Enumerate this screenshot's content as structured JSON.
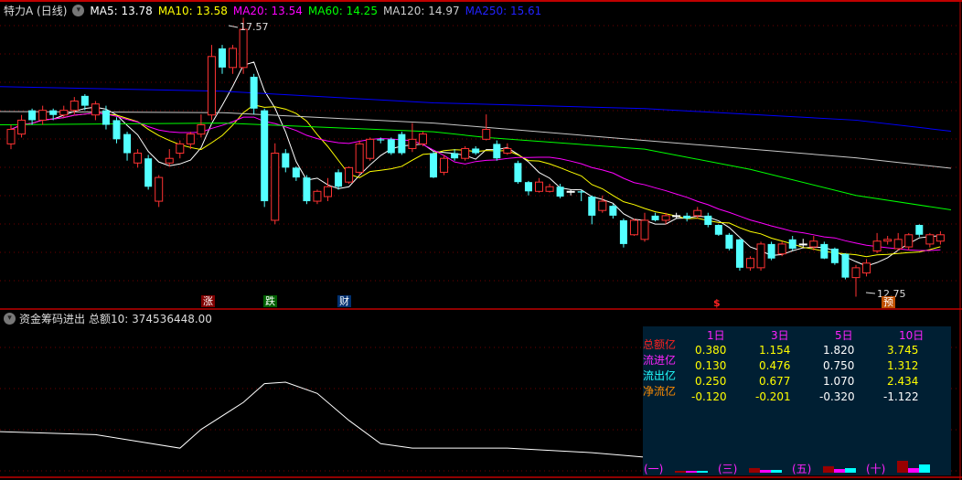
{
  "header": {
    "title": "特力A (日线)",
    "ma5": "MA5: 13.78",
    "ma10": "MA10: 13.58",
    "ma20": "MA20: 13.54",
    "ma60": "MA60: 14.25",
    "ma120": "MA120: 14.97",
    "ma250": "MA250: 15.61"
  },
  "annotations": {
    "high": "17.57",
    "low": "12.75",
    "tag_up": "涨",
    "tag_down": "跌",
    "tag_fin": "财",
    "tag_s": "$",
    "tag_pre": "预"
  },
  "indicator": {
    "title": "资金筹码进出",
    "total": "总额10: 374536448.00"
  },
  "table": {
    "columns": [
      "1日",
      "3日",
      "5日",
      "10日"
    ],
    "rows": [
      {
        "label": "总额亿",
        "color": "#ff2020",
        "values": [
          "0.380",
          "1.154",
          "1.820",
          "3.745"
        ]
      },
      {
        "label": "流进亿",
        "color": "#ff22ff",
        "values": [
          "0.130",
          "0.476",
          "0.750",
          "1.312"
        ]
      },
      {
        "label": "流出亿",
        "color": "#22ffff",
        "values": [
          "0.250",
          "0.677",
          "1.070",
          "2.434"
        ]
      },
      {
        "label": "净流亿",
        "color": "#ff8c00",
        "values": [
          "-0.120",
          "-0.201",
          "-0.320",
          "-1.122"
        ]
      }
    ],
    "bar_groups": [
      {
        "label": "(一)",
        "values": [
          0.13,
          0.13,
          0.13
        ]
      },
      {
        "label": "(三)",
        "values": [
          0.38,
          0.21,
          0.21
        ]
      },
      {
        "label": "(五)",
        "values": [
          0.55,
          0.33,
          0.38
        ]
      },
      {
        "label": "(十)",
        "values": [
          1.0,
          0.38,
          0.7
        ]
      }
    ]
  },
  "colors": {
    "up": "#ff3232",
    "down": "#54ffff",
    "ma5": "#ffffff",
    "ma10": "#ffff00",
    "ma20": "#ff00ff",
    "ma60": "#00ff00",
    "ma120": "#c8c8c8",
    "ma250": "#0000ff",
    "bg": "#000000"
  },
  "chart_data": {
    "type": "candlestick",
    "ylim": [
      12.6,
      17.75
    ],
    "candles_ocHL": [
      [
        15.39,
        15.64,
        15.72,
        15.3
      ],
      [
        15.56,
        15.8,
        15.89,
        15.5
      ],
      [
        15.97,
        15.8,
        16.0,
        15.72
      ],
      [
        15.8,
        15.97,
        16.05,
        15.72
      ],
      [
        15.97,
        15.89,
        16.0,
        15.8
      ],
      [
        15.89,
        15.97,
        16.05,
        15.85
      ],
      [
        15.97,
        16.13,
        16.2,
        15.9
      ],
      [
        16.22,
        16.05,
        16.25,
        15.97
      ],
      [
        15.89,
        16.08,
        16.13,
        15.8
      ],
      [
        15.97,
        15.72,
        16.05,
        15.64
      ],
      [
        15.8,
        15.47,
        15.85,
        15.4
      ],
      [
        15.56,
        15.23,
        15.6,
        15.1
      ],
      [
        15.06,
        15.23,
        15.3,
        14.98
      ],
      [
        15.14,
        14.65,
        15.2,
        14.6
      ],
      [
        14.4,
        14.81,
        14.85,
        14.3
      ],
      [
        15.06,
        15.14,
        15.3,
        15.0
      ],
      [
        15.23,
        15.39,
        15.45,
        15.14
      ],
      [
        15.39,
        15.56,
        15.6,
        15.3
      ],
      [
        15.56,
        15.72,
        15.9,
        15.5
      ],
      [
        15.89,
        16.9,
        17.1,
        15.8
      ],
      [
        17.04,
        16.71,
        17.1,
        16.6
      ],
      [
        16.71,
        17.04,
        17.1,
        16.6
      ],
      [
        16.71,
        17.37,
        17.57,
        16.6
      ],
      [
        16.55,
        16.0,
        16.6,
        15.9
      ],
      [
        15.97,
        14.4,
        16.0,
        14.3
      ],
      [
        14.07,
        15.23,
        15.4,
        14.0
      ],
      [
        15.23,
        14.98,
        15.3,
        14.9
      ],
      [
        14.98,
        14.81,
        15.0,
        14.75
      ],
      [
        14.81,
        14.4,
        14.85,
        14.35
      ],
      [
        14.4,
        14.57,
        14.6,
        14.35
      ],
      [
        14.48,
        14.65,
        14.8,
        14.4
      ],
      [
        14.9,
        14.65,
        14.95,
        14.6
      ],
      [
        14.73,
        14.98,
        15.0,
        14.7
      ],
      [
        14.9,
        15.39,
        15.45,
        14.85
      ],
      [
        15.14,
        15.47,
        15.5,
        15.1
      ],
      [
        15.47,
        15.45,
        15.5,
        15.4
      ],
      [
        15.47,
        15.23,
        15.5,
        15.2
      ],
      [
        15.56,
        15.23,
        15.6,
        15.2
      ],
      [
        15.31,
        15.47,
        15.75,
        15.25
      ],
      [
        15.39,
        15.56,
        15.6,
        15.35
      ],
      [
        15.23,
        14.81,
        15.25,
        14.8
      ],
      [
        14.9,
        15.14,
        15.2,
        14.85
      ],
      [
        15.23,
        15.14,
        15.3,
        15.1
      ],
      [
        15.14,
        15.31,
        15.35,
        15.1
      ],
      [
        15.31,
        15.23,
        15.35,
        15.2
      ],
      [
        15.47,
        15.64,
        15.9,
        15.45
      ],
      [
        15.39,
        15.14,
        15.45,
        15.1
      ],
      [
        15.23,
        15.31,
        15.4,
        15.2
      ],
      [
        15.06,
        14.73,
        15.1,
        14.7
      ],
      [
        14.73,
        14.57,
        14.75,
        14.5
      ],
      [
        14.57,
        14.73,
        14.8,
        14.55
      ],
      [
        14.57,
        14.65,
        14.7,
        14.55
      ],
      [
        14.65,
        14.48,
        14.7,
        14.45
      ],
      [
        14.57,
        14.57,
        14.6,
        14.5
      ],
      [
        14.57,
        14.55,
        14.6,
        14.4
      ],
      [
        14.48,
        14.15,
        14.5,
        14.0
      ],
      [
        14.24,
        14.4,
        14.5,
        14.2
      ],
      [
        14.32,
        14.15,
        14.35,
        14.1
      ],
      [
        14.07,
        13.66,
        14.1,
        13.6
      ],
      [
        13.82,
        14.07,
        14.1,
        13.8
      ],
      [
        13.74,
        14.07,
        14.2,
        13.7
      ],
      [
        14.15,
        14.07,
        14.2,
        14.05
      ],
      [
        14.07,
        14.15,
        14.2,
        14.0
      ],
      [
        14.15,
        14.15,
        14.2,
        14.1
      ],
      [
        14.15,
        14.1,
        14.2,
        14.05
      ],
      [
        14.15,
        14.24,
        14.3,
        14.1
      ],
      [
        14.15,
        13.99,
        14.2,
        13.95
      ],
      [
        13.99,
        13.82,
        14.0,
        13.8
      ],
      [
        13.82,
        13.58,
        13.85,
        13.55
      ],
      [
        13.74,
        13.25,
        13.75,
        13.2
      ],
      [
        13.25,
        13.41,
        13.45,
        13.2
      ],
      [
        13.25,
        13.66,
        13.7,
        13.2
      ],
      [
        13.66,
        13.41,
        13.7,
        13.38
      ],
      [
        13.49,
        13.66,
        13.7,
        13.45
      ],
      [
        13.74,
        13.58,
        13.8,
        13.55
      ],
      [
        13.66,
        13.66,
        13.75,
        13.6
      ],
      [
        13.61,
        13.71,
        13.8,
        13.55
      ],
      [
        13.66,
        13.41,
        13.7,
        13.4
      ],
      [
        13.58,
        13.33,
        13.6,
        13.3
      ],
      [
        13.49,
        13.08,
        13.5,
        13.05
      ],
      [
        13.08,
        13.25,
        13.3,
        12.75
      ],
      [
        13.16,
        13.33,
        13.4,
        13.1
      ],
      [
        13.54,
        13.71,
        13.85,
        13.5
      ],
      [
        13.71,
        13.74,
        13.8,
        13.65
      ],
      [
        13.58,
        13.74,
        13.85,
        13.55
      ],
      [
        13.61,
        13.82,
        13.85,
        13.55
      ],
      [
        13.99,
        13.82,
        14.0,
        13.78
      ],
      [
        13.66,
        13.82,
        13.85,
        13.6
      ],
      [
        13.71,
        13.82,
        13.88,
        13.65
      ]
    ],
    "long_ma": {
      "ma60": [
        [
          0,
          15.72
        ],
        [
          20,
          15.75
        ],
        [
          40,
          15.6
        ],
        [
          45,
          15.5
        ],
        [
          60,
          15.3
        ],
        [
          70,
          14.95
        ],
        [
          80,
          14.5
        ],
        [
          89,
          14.25
        ]
      ],
      "ma120": [
        [
          0,
          15.95
        ],
        [
          20,
          15.93
        ],
        [
          40,
          15.75
        ],
        [
          60,
          15.45
        ],
        [
          80,
          15.15
        ],
        [
          89,
          14.97
        ]
      ],
      "ma250": [
        [
          0,
          16.38
        ],
        [
          20,
          16.3
        ],
        [
          40,
          16.1
        ],
        [
          60,
          16.0
        ],
        [
          80,
          15.8
        ],
        [
          89,
          15.61
        ]
      ]
    },
    "indicator_curve": [
      [
        0,
        34
      ],
      [
        8,
        30
      ],
      [
        16,
        12
      ],
      [
        18,
        37
      ],
      [
        22,
        73
      ],
      [
        24,
        98
      ],
      [
        26,
        100
      ],
      [
        29,
        85
      ],
      [
        32,
        49
      ],
      [
        35,
        18
      ],
      [
        38,
        12
      ],
      [
        47,
        12
      ],
      [
        55,
        6
      ],
      [
        60,
        0
      ]
    ]
  }
}
